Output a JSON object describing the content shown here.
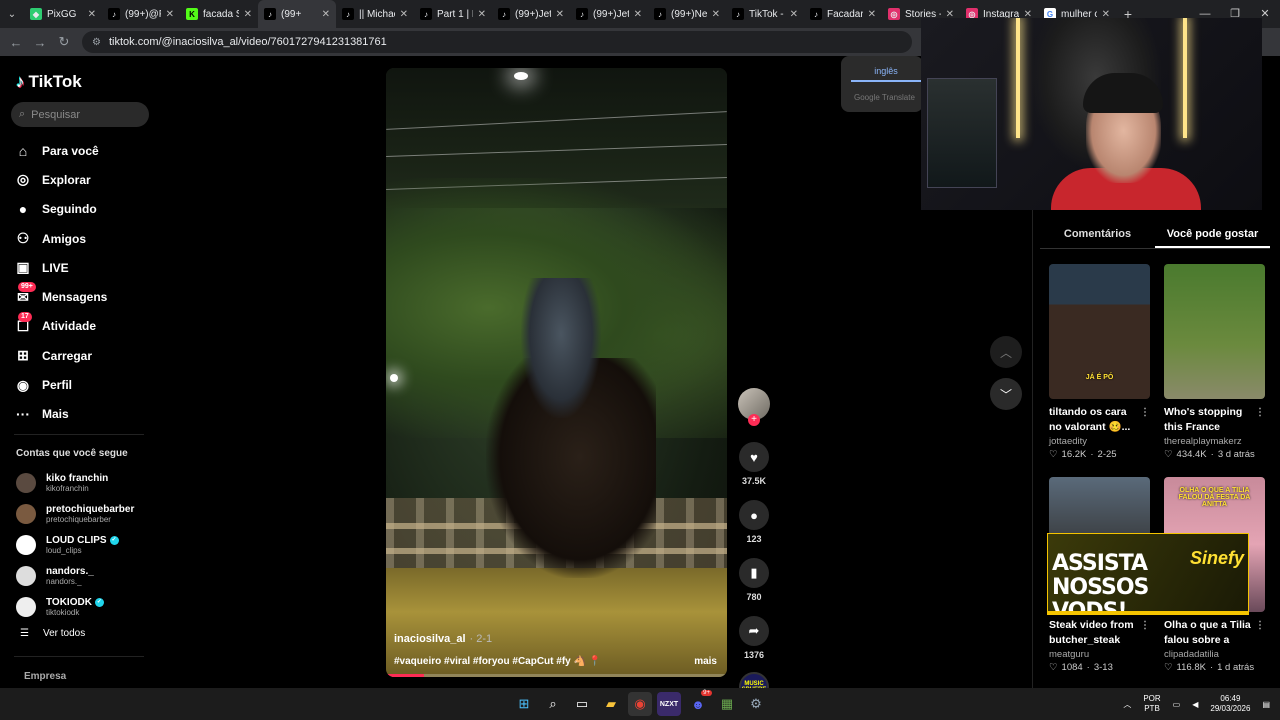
{
  "browser": {
    "tabs": [
      {
        "title": "PixGG",
        "favicon": "pixgg-icon",
        "color": "#2ecc71"
      },
      {
        "title": "(99+)@F",
        "favicon": "tiktok-icon",
        "color": "#000000"
      },
      {
        "title": "facada S",
        "favicon": "kick-icon",
        "color": "#53fc18"
      },
      {
        "title": "(99+",
        "favicon": "tiktok-icon",
        "color": "#000000",
        "active": true
      },
      {
        "title": "|| Michae",
        "favicon": "tiktok-icon",
        "color": "#000000"
      },
      {
        "title": "Part 1 | M",
        "favicon": "tiktok-icon",
        "color": "#000000"
      },
      {
        "title": "(99+)Jett",
        "favicon": "tiktok-icon",
        "color": "#000000"
      },
      {
        "title": "(99+)Jett",
        "favicon": "tiktok-icon",
        "color": "#000000"
      },
      {
        "title": "(99+)Ne",
        "favicon": "tiktok-icon",
        "color": "#000000"
      },
      {
        "title": "TikTok -",
        "favicon": "tiktok-icon",
        "color": "#000000"
      },
      {
        "title": "Facadar",
        "favicon": "tiktok-icon",
        "color": "#000000"
      },
      {
        "title": "Stories -",
        "favicon": "instagram-icon",
        "color": "#e1306c"
      },
      {
        "title": "Instagra",
        "favicon": "instagram-icon",
        "color": "#e1306c"
      },
      {
        "title": "mulher c",
        "favicon": "google-icon",
        "color": "#ffffff"
      }
    ],
    "url": "tiktok.com/@inaciosilva_al/video/7601727941231381761"
  },
  "sidebar": {
    "brand": "TikTok",
    "search_placeholder": "Pesquisar",
    "menu": [
      {
        "label": "Para você",
        "icon": "home-icon",
        "glyph": "⌂"
      },
      {
        "label": "Explorar",
        "icon": "compass-icon",
        "glyph": "◎"
      },
      {
        "label": "Seguindo",
        "icon": "following-icon",
        "glyph": "●"
      },
      {
        "label": "Amigos",
        "icon": "friends-icon",
        "glyph": "⚇"
      },
      {
        "label": "LIVE",
        "icon": "live-icon",
        "glyph": "▣"
      },
      {
        "label": "Mensagens",
        "icon": "messages-icon",
        "glyph": "✉",
        "badge": "99+"
      },
      {
        "label": "Atividade",
        "icon": "activity-icon",
        "glyph": "☐",
        "badge": "17"
      },
      {
        "label": "Carregar",
        "icon": "upload-icon",
        "glyph": "⊞"
      },
      {
        "label": "Perfil",
        "icon": "profile-icon",
        "glyph": "◉"
      },
      {
        "label": "Mais",
        "icon": "more-icon",
        "glyph": "···"
      }
    ],
    "following_title": "Contas que você segue",
    "following": [
      {
        "name": "kiko franchin",
        "user": "kikofranchin",
        "verified": false,
        "color": "#5a4a40"
      },
      {
        "name": "pretochiquebarber",
        "user": "pretochiquebarber",
        "verified": false,
        "color": "#7a5a40"
      },
      {
        "name": "LOUD CLIPS",
        "user": "loud_clips",
        "verified": true,
        "color": "#ffffff"
      },
      {
        "name": "nandors._",
        "user": "nandors._",
        "verified": false,
        "color": "#dddddd"
      },
      {
        "name": "TOKIODK",
        "user": "tiktokiodk",
        "verified": true,
        "color": "#eeeeee"
      }
    ],
    "see_all": "Ver todos",
    "footer": "Empresa"
  },
  "video": {
    "author": "inaciosilva_al",
    "date": "· 2-1",
    "caption": "#vaqueiro #viral #foryou #CapCut #fy 🐴 📍",
    "more": "mais",
    "progress": 0.11
  },
  "actions": {
    "like_count": "37.5K",
    "comment_count": "123",
    "save_count": "780",
    "share_count": "1376",
    "music_label": "MUSIC SPHERE"
  },
  "translate": {
    "language": "inglês",
    "provider": "Google Translate"
  },
  "right_panel": {
    "tabs": [
      "Comentários",
      "Você pode gostar"
    ],
    "active_tab": 1,
    "cards": [
      {
        "title": "tiltando os cara no valorant 🥴...",
        "user": "jottaedity",
        "likes": "16.2K",
        "date": "2-25",
        "thumb_caption": "JÁ É PÓ"
      },
      {
        "title": "Who's stopping this France attac...",
        "user": "therealplaymakerz",
        "likes": "434.4K",
        "date": "3 d atrás"
      },
      {
        "title": "Steak video from butcher_steak",
        "user": "meatguru",
        "likes": "1084",
        "date": "3-13"
      },
      {
        "title": "Olha o que a Tilia falou sobre a fes...",
        "user": "clipadadatilia",
        "likes": "116.8K",
        "date": "1 d atrás",
        "thumb_caption": "OLHA O QUE A TILIA FALOU DA FESTA DA ANITTA"
      }
    ]
  },
  "ad": {
    "text": "ASSISTA NOSSOS VODS!",
    "brand": "Sinefy"
  },
  "taskbar": {
    "lang_top": "POR",
    "lang_bottom": "PTB",
    "time": "06:49",
    "date": "29/03/2026",
    "discord_badge": "9+"
  }
}
